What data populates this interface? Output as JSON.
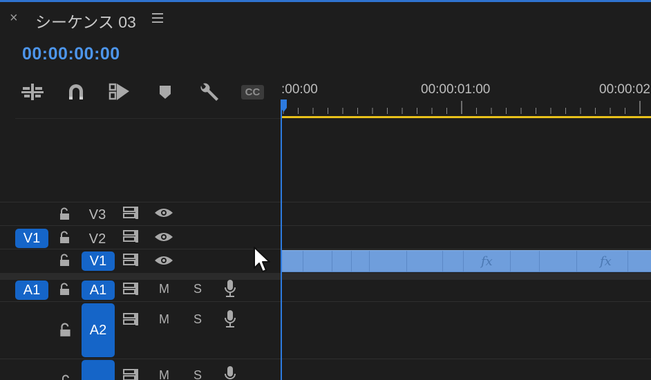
{
  "panel": {
    "close": "×",
    "title": "シーケンス 03",
    "menu_icon": "hamburger-menu-icon"
  },
  "timecode": "00:00:00:00",
  "toolbar": {
    "icons": [
      "insert-nest-icon",
      "snap-magnet-icon",
      "linked-selection-icon",
      "add-marker-icon",
      "wrench-settings-icon",
      "captions-cc-icon"
    ],
    "cc_label": "CC"
  },
  "ruler": {
    "labels": [
      ":00:00",
      "00:00:01:00",
      "00:00:02"
    ]
  },
  "tracks": {
    "source_patch_video": "V1",
    "source_patch_audio": "A1",
    "video": [
      {
        "name": "V3"
      },
      {
        "name": "V2"
      },
      {
        "name": "V1"
      }
    ],
    "audio": [
      {
        "name": "A1",
        "mute": "M",
        "solo": "S"
      },
      {
        "name": "A2",
        "mute": "M",
        "solo": "S"
      },
      {
        "name": "",
        "mute": "M",
        "solo": "S"
      }
    ]
  },
  "clip": {
    "fx_label": "fx",
    "color": "#6f9edc"
  },
  "colors": {
    "accent": "#2d7be0",
    "timecode": "#4d95ea",
    "work_area": "#e8c11b",
    "chip": "#1565c8"
  }
}
